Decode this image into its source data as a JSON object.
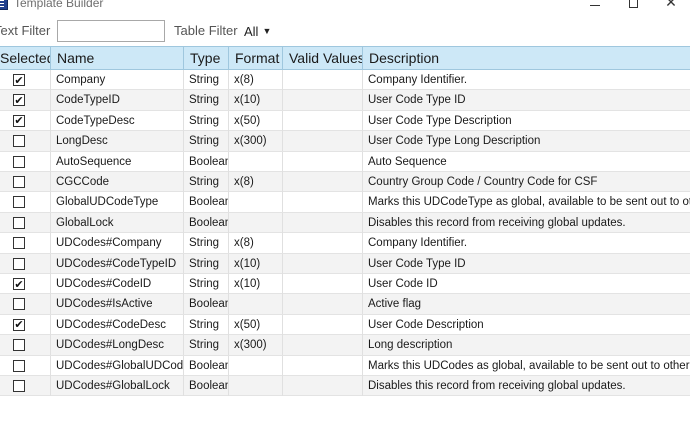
{
  "window": {
    "title": "Template Builder",
    "minimize_glyph": "minimize-icon",
    "maximize_glyph": "maximize-icon",
    "close_glyph": "✕"
  },
  "filters": {
    "text_filter_label": "Text Filter",
    "text_filter_value": "",
    "table_filter_label": "Table Filter",
    "table_filter_value": "All",
    "dropdown_icon": "chevron-down-icon"
  },
  "columns": {
    "selected": "Selected",
    "name": "Name",
    "type": "Type",
    "format": "Format",
    "valid_values": "Valid Values",
    "description": "Description"
  },
  "rows": [
    {
      "selected": true,
      "name": "Company",
      "type": "String",
      "format": "x(8)",
      "valid_values": "",
      "description": "Company Identifier."
    },
    {
      "selected": true,
      "name": "CodeTypeID",
      "type": "String",
      "format": "x(10)",
      "valid_values": "",
      "description": "User Code Type ID"
    },
    {
      "selected": true,
      "name": "CodeTypeDesc",
      "type": "String",
      "format": "x(50)",
      "valid_values": "",
      "description": "User Code Type Description"
    },
    {
      "selected": false,
      "name": "LongDesc",
      "type": "String",
      "format": "x(300)",
      "valid_values": "",
      "description": "User Code Type Long Description"
    },
    {
      "selected": false,
      "name": "AutoSequence",
      "type": "Boolean",
      "format": "",
      "valid_values": "",
      "description": "Auto Sequence"
    },
    {
      "selected": false,
      "name": "CGCCode",
      "type": "String",
      "format": "x(8)",
      "valid_values": "",
      "description": "Country Group Code / Country Code for CSF"
    },
    {
      "selected": false,
      "name": "GlobalUDCodeType",
      "type": "Boolean",
      "format": "",
      "valid_values": "",
      "description": "Marks this UDCodeType as global, available to be sent out to other c"
    },
    {
      "selected": false,
      "name": "GlobalLock",
      "type": "Boolean",
      "format": "",
      "valid_values": "",
      "description": "Disables this record from receiving global updates."
    },
    {
      "selected": false,
      "name": "UDCodes#Company",
      "type": "String",
      "format": "x(8)",
      "valid_values": "",
      "description": "Company Identifier."
    },
    {
      "selected": false,
      "name": "UDCodes#CodeTypeID",
      "type": "String",
      "format": "x(10)",
      "valid_values": "",
      "description": "User Code Type ID"
    },
    {
      "selected": true,
      "name": "UDCodes#CodeID",
      "type": "String",
      "format": "x(10)",
      "valid_values": "",
      "description": "User Code ID"
    },
    {
      "selected": false,
      "name": "UDCodes#IsActive",
      "type": "Boolean",
      "format": "",
      "valid_values": "",
      "description": "Active flag"
    },
    {
      "selected": true,
      "name": "UDCodes#CodeDesc",
      "type": "String",
      "format": "x(50)",
      "valid_values": "",
      "description": "User Code Description"
    },
    {
      "selected": false,
      "name": "UDCodes#LongDesc",
      "type": "String",
      "format": "x(300)",
      "valid_values": "",
      "description": "Long description"
    },
    {
      "selected": false,
      "name": "UDCodes#GlobalUDCodes",
      "type": "Boolean",
      "format": "",
      "valid_values": "",
      "description": "Marks this UDCodes as global, available to be sent out to other comp"
    },
    {
      "selected": false,
      "name": "UDCodes#GlobalLock",
      "type": "Boolean",
      "format": "",
      "valid_values": "",
      "description": "Disables this record from receiving global updates."
    }
  ],
  "colors": {
    "header_bg": "#cde8f7",
    "header_border": "#9fc7de",
    "alt_row_bg": "#f3f3f3",
    "app_icon": "#1f3f8f"
  },
  "check_glyph": "✔"
}
